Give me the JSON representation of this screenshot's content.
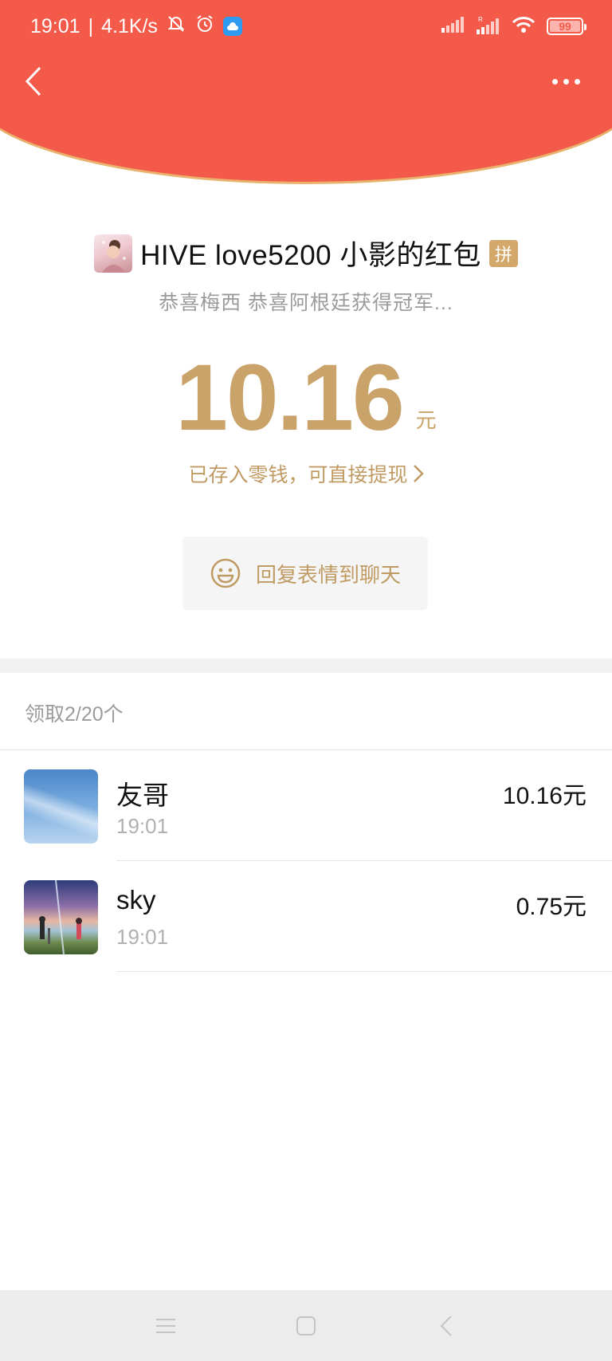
{
  "status_bar": {
    "time": "19:01",
    "speed": "4.1K/s",
    "battery": "99",
    "icons": [
      "mute-bell-icon",
      "alarm-icon",
      "cloud-app-icon",
      "signal-icon",
      "signal-r-icon",
      "wifi-icon",
      "battery-icon"
    ]
  },
  "nav": {
    "back_icon": "chevron-left-icon",
    "more_icon": "more-dots-icon"
  },
  "sender": {
    "name": "HIVE love5200 小影的红包",
    "badge": "拼",
    "greeting": "恭喜梅西 恭喜阿根廷获得冠军..."
  },
  "amount": {
    "value": "10.16",
    "unit": "元",
    "stored_text": "已存入零钱，可直接提现"
  },
  "reply_button": {
    "label": "回复表情到聊天",
    "icon": "smiley-icon"
  },
  "claims": {
    "count_label": "领取2/20个",
    "items": [
      {
        "name": "友哥",
        "time": "19:01",
        "amount": "10.16元",
        "avatar": "sky-avatar"
      },
      {
        "name": "sky",
        "time": "19:01",
        "amount": "0.75元",
        "avatar": "anime-avatar"
      }
    ]
  },
  "system_nav": {
    "icons": [
      "menu-icon",
      "home-square-icon",
      "back-triangle-icon"
    ]
  },
  "colors": {
    "header_red": "#f45a4a",
    "gold": "#c9a36a",
    "gold_border": "#e9b26d"
  }
}
